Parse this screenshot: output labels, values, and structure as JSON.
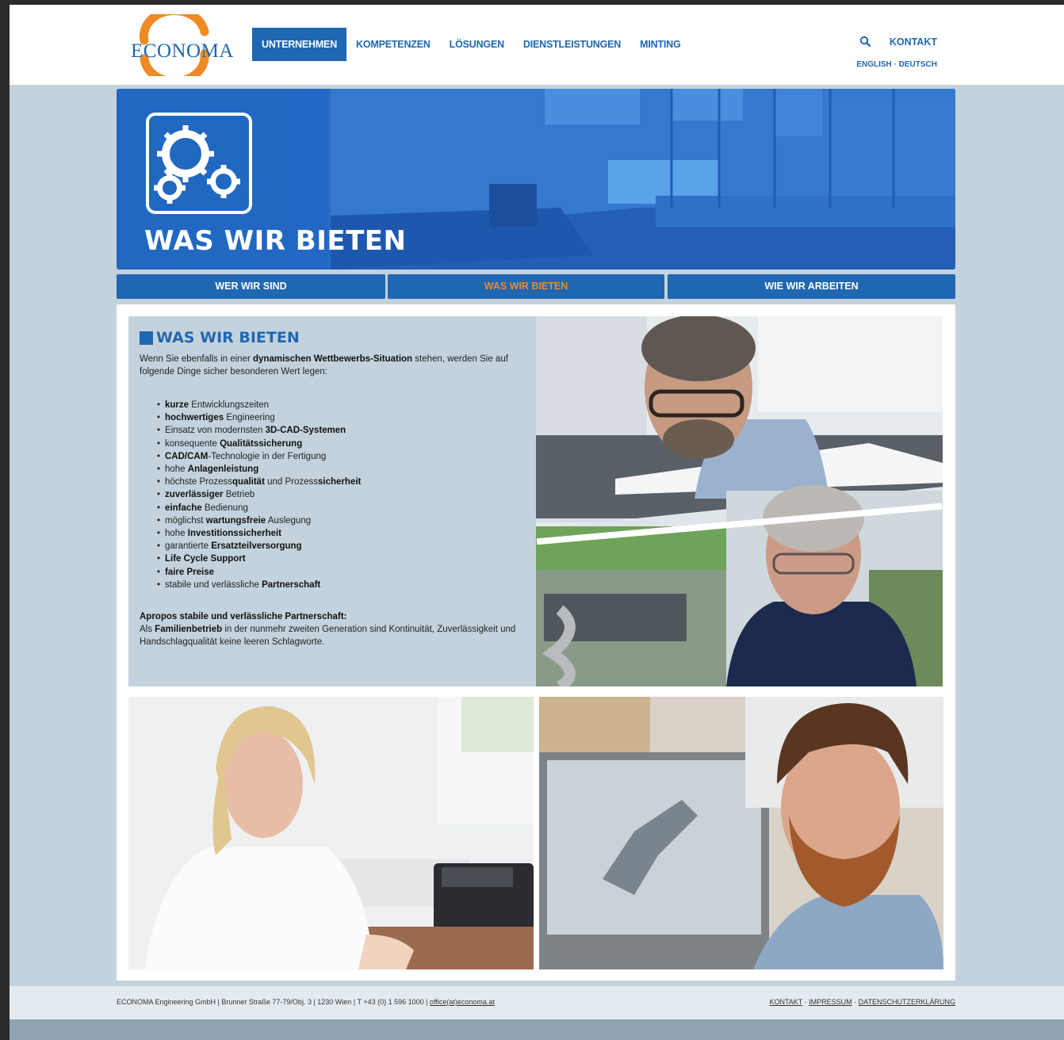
{
  "brand": {
    "logo_text": "ECONOMA",
    "primary": "#1f67b1",
    "accent": "#f08a24"
  },
  "nav": {
    "items": [
      "UNTERNEHMEN",
      "KOMPETENZEN",
      "LÖSUNGEN",
      "DIENSTLEISTUNGEN",
      "MINTING"
    ],
    "active": "UNTERNEHMEN"
  },
  "top": {
    "search_icon": "search-icon",
    "kontakt": "KONTAKT",
    "lang": "ENGLISH · DEUTSCH"
  },
  "hero": {
    "icon": "gears-icon",
    "title": "WAS WIR BIETEN"
  },
  "subnav": {
    "items": [
      "WER WIR SIND",
      "WAS WIR BIETEN",
      "WIE WIR ARBEITEN"
    ],
    "active": "WAS WIR BIETEN"
  },
  "content": {
    "title": "WAS WIR BIETEN",
    "intro_pre": "Wenn Sie ebenfalls in einer ",
    "intro_bold": "dynamischen Wettbewerbs-Situation",
    "intro_post": " stehen, werden Sie auf folgende Dinge sicher besonderen Wert legen:",
    "bullets": [
      [
        {
          "b": "kurze"
        },
        {
          "t": " Entwicklungszeiten"
        }
      ],
      [
        {
          "b": "hochwertiges"
        },
        {
          "t": " Engineering"
        }
      ],
      [
        {
          "t": "Einsatz von modernsten "
        },
        {
          "b": "3D-CAD-Systemen"
        }
      ],
      [
        {
          "t": "konsequente "
        },
        {
          "b": "Qualitätssicherung"
        }
      ],
      [
        {
          "b": "CAD/CAM"
        },
        {
          "t": "-Technologie in der Fertigung"
        }
      ],
      [
        {
          "t": "hohe "
        },
        {
          "b": "Anlagenleistung"
        }
      ],
      [
        {
          "t": "höchste Prozess"
        },
        {
          "b": "qualität"
        },
        {
          "t": " und Prozess"
        },
        {
          "b": "sicherheit"
        }
      ],
      [
        {
          "b": "zuverlässiger"
        },
        {
          "t": " Betrieb"
        }
      ],
      [
        {
          "b": "einfache"
        },
        {
          "t": " Bedienung"
        }
      ],
      [
        {
          "t": "möglichst "
        },
        {
          "b": "wartungsfreie"
        },
        {
          "t": " Auslegung"
        }
      ],
      [
        {
          "t": "hohe "
        },
        {
          "b": "Investitionssicherheit"
        }
      ],
      [
        {
          "t": "garantierte "
        },
        {
          "b": "Ersatzteilversorgung"
        }
      ],
      [
        {
          "b": "Life Cycle Support"
        }
      ],
      [
        {
          "b": "faire Preise"
        }
      ],
      [
        {
          "t": "stabile und verlässliche "
        },
        {
          "b": "Partnerschaft"
        }
      ]
    ],
    "closing_head": "Apropos stabile und verlässliche Partnerschaft:",
    "closing_pre": "Als ",
    "closing_bold": "Familienbetrieb",
    "closing_post": " in der nunmehr zweiten Generation sind Kontinuität, Zuverlässigkeit und Handschlagqualität keine leeren Schlagworte."
  },
  "footer": {
    "address": "ECONOMA Engineering GmbH | Brunner Straße 77-79/Obj. 3 | 1230 Wien | T +43 (0) 1 596 1000 | ",
    "email": "office(at)economa.at",
    "links": [
      "KONTAKT",
      "IMPRESSUM",
      "DATENSCHUTZERKLÄRUNG"
    ],
    "link_sep": " · "
  }
}
